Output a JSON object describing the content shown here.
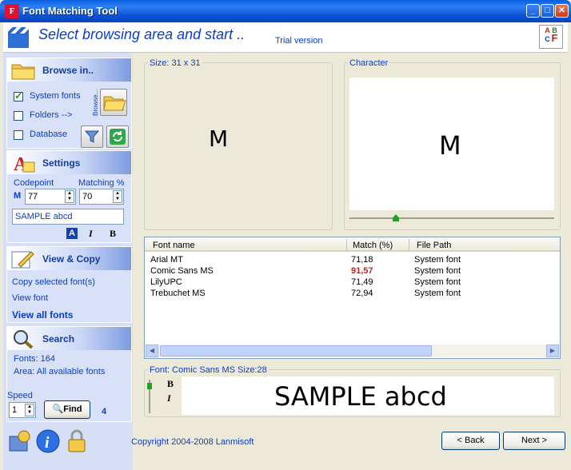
{
  "window": {
    "title": "Font Matching Tool",
    "app_icon": "F"
  },
  "header": {
    "title": "Select browsing area and start ..",
    "trial": "Trial version",
    "logo_letters": [
      "A",
      "B",
      "C",
      "F"
    ]
  },
  "browse": {
    "title": "Browse in..",
    "options": [
      {
        "label": "System fonts",
        "checked": true
      },
      {
        "label": "Folders -->",
        "checked": false
      },
      {
        "label": "Database",
        "checked": false
      }
    ],
    "browse_vertical_label": "Browse..."
  },
  "settings": {
    "title": "Settings",
    "codepoint_label": "Codepoint",
    "matching_label": "Matching %",
    "codepoint_prefix": "M",
    "codepoint_value": "77",
    "matching_value": "70",
    "sample_text": "SAMPLE abcd",
    "style_buttons": [
      "A",
      "I",
      "B"
    ]
  },
  "view_copy": {
    "title": "View & Copy",
    "links": [
      "Copy selected font(s)",
      "View font",
      "View all fonts"
    ]
  },
  "search": {
    "title": "Search",
    "fonts_count": "Fonts: 164",
    "area": "Area: All available fonts",
    "speed_label": "Speed",
    "speed_value": "1",
    "find_label": "Find",
    "counter": "4"
  },
  "size_panel": {
    "label": "Size: 31 x 31",
    "glyph": "M"
  },
  "character_panel": {
    "label": "Character",
    "glyph": "M"
  },
  "results": {
    "columns": [
      "Font name",
      "Match (%)",
      "File Path"
    ],
    "rows": [
      {
        "name": "Arial MT",
        "match": "71,18",
        "path": "System font",
        "highlight": false
      },
      {
        "name": "Comic Sans MS",
        "match": "91,57",
        "path": "System font",
        "highlight": true
      },
      {
        "name": "LilyUPC",
        "match": "71,49",
        "path": "System font",
        "highlight": false
      },
      {
        "name": "Trebuchet MS",
        "match": "72,94",
        "path": "System font",
        "highlight": false
      }
    ]
  },
  "preview": {
    "label": "Font: Comic Sans MS  Size:28",
    "sample": "SAMPLE abcd",
    "style_bold": "B",
    "style_italic": "I"
  },
  "footer": {
    "copyright": "Copyright 2004-2008 Lanmisoft",
    "back_label": "< Back",
    "next_label": "Next >"
  },
  "colors": {
    "accent": "#0a3dc8",
    "highlight_red": "#d41b1b",
    "panel_bg": "#d8e1f8"
  }
}
